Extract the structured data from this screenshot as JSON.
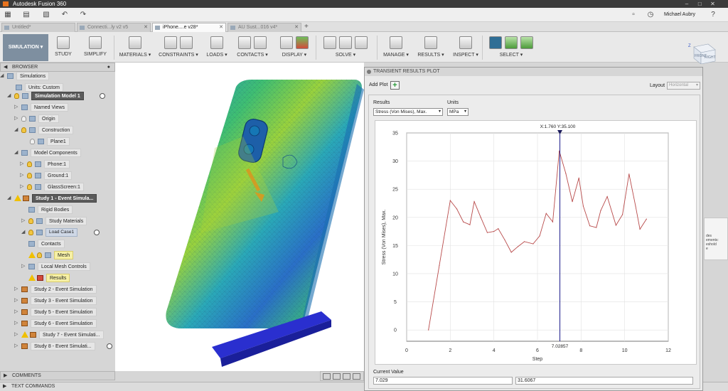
{
  "app": {
    "title": "Autodesk Fusion 360"
  },
  "user": {
    "name": "Michael Aubry"
  },
  "tabs": [
    {
      "label": "Untitled*"
    },
    {
      "label": "Connecti...ly v2 v5"
    },
    {
      "label": "iPhone....e v28*"
    },
    {
      "label": "AU Sust...016 v4*"
    }
  ],
  "toolbar": {
    "workspace": "SIMULATION",
    "study": "STUDY",
    "simplify": "SIMPLIFY",
    "materials": "MATERIALS",
    "constraints": "CONSTRAINTS",
    "loads": "LOADS",
    "contacts": "CONTACTS",
    "display": "DISPLAY",
    "solve": "SOLVE",
    "manage": "MANAGE",
    "results": "RESULTS",
    "inspect": "INSPECT",
    "select": "SELECT"
  },
  "viewcube": {
    "front": "FRONT",
    "right": "RIGHT",
    "axis": "Z"
  },
  "browser": {
    "header": "BROWSER",
    "nodes": [
      {
        "label": "Simulations"
      },
      {
        "label": "Units: Custom"
      },
      {
        "label": "Simulation Model 1"
      },
      {
        "label": "Named Views"
      },
      {
        "label": "Origin"
      },
      {
        "label": "Construction"
      },
      {
        "label": "Plane1"
      },
      {
        "label": "Model Components"
      },
      {
        "label": "Phone:1"
      },
      {
        "label": "Ground:1"
      },
      {
        "label": "GlassScreen:1"
      },
      {
        "label": "Study 1 - Event Simula..."
      },
      {
        "label": "Rigid Bodies"
      },
      {
        "label": "Study Materials"
      },
      {
        "label": "Load Case1"
      },
      {
        "label": "Contacts"
      },
      {
        "label": "Mesh"
      },
      {
        "label": "Local Mesh Controls"
      },
      {
        "label": "Results"
      },
      {
        "label": "Study 2 - Event Simulation"
      },
      {
        "label": "Study 3 - Event Simulation"
      },
      {
        "label": "Study 5 - Event Simulation"
      },
      {
        "label": "Study 6 - Event Simulation"
      },
      {
        "label": "Study 7 - Event Simulati..."
      },
      {
        "label": "Study 8 - Event Simulati..."
      }
    ]
  },
  "comments": {
    "label": "COMMENTS"
  },
  "textcommands": {
    "label": "TEXT COMMANDS"
  },
  "dialog": {
    "title": "TRANSIENT RESULTS PLOT",
    "add_plot": "Add Plot",
    "add_symbol": "+",
    "layout_label": "Layout",
    "layout_value": "Horizontal",
    "results_label": "Results",
    "results_value": "Stress (Von Mises), Max.",
    "units_label": "Units",
    "units_value": "MPa",
    "current_value_label": "Current Value",
    "current_x": "7.029",
    "current_y": "31.6067"
  },
  "side_panel": {
    "lines": [
      "des",
      "ements:",
      "eshold",
      "e"
    ]
  },
  "chart_data": {
    "type": "line",
    "title": "",
    "xlabel": "Step",
    "ylabel": "Stress (Von Mises), Max.",
    "xlim": [
      0,
      12
    ],
    "ylim": [
      -2,
      35
    ],
    "xticks": [
      0,
      2,
      4,
      6,
      8,
      10,
      12
    ],
    "yticks": [
      0,
      5,
      10,
      15,
      20,
      25,
      30,
      35
    ],
    "grid": true,
    "cursor": {
      "x": 7.02857,
      "readout": "X:1.760 Y:35.100",
      "x_label": "7.02857"
    },
    "color": "#b84a4a",
    "series": [
      {
        "x": [
          1.0,
          1.5,
          2.0,
          2.3,
          2.6,
          2.9,
          3.1,
          3.4,
          3.7,
          4.0,
          4.2,
          4.5,
          4.8,
          5.1,
          5.4,
          5.8,
          6.1,
          6.4,
          6.7,
          7.0,
          7.3,
          7.6,
          7.9,
          8.1,
          8.4,
          8.7,
          8.9,
          9.2,
          9.6,
          9.9,
          10.2,
          10.5,
          10.7,
          11.0
        ],
        "y": [
          0.0,
          11.5,
          23.0,
          21.5,
          19.2,
          18.7,
          22.8,
          20.0,
          17.3,
          17.5,
          18.0,
          16.0,
          13.8,
          14.8,
          15.7,
          15.3,
          16.7,
          20.7,
          19.2,
          31.8,
          27.8,
          22.8,
          27.0,
          22.0,
          18.5,
          18.2,
          21.2,
          23.7,
          18.6,
          20.5,
          27.7,
          22.0,
          17.9,
          19.7
        ]
      }
    ]
  }
}
